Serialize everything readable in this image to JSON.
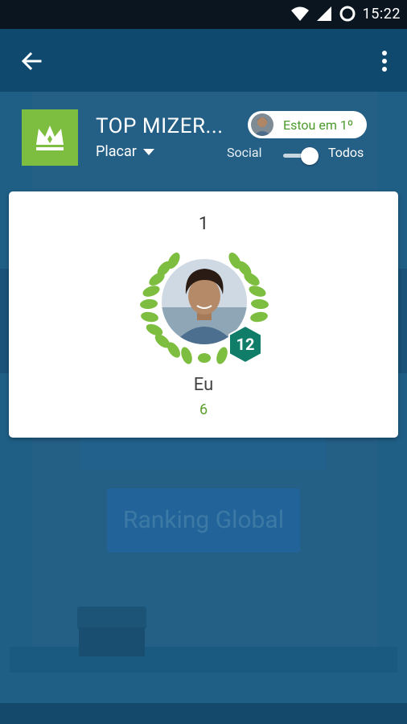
{
  "status_bar": {
    "time": "15:22"
  },
  "header": {
    "title": "TOP MIZER...",
    "placar_label": "Placar",
    "pill_text": "Estou em 1º",
    "social_label": "Social",
    "todos_label": "Todos",
    "toggle_on": true
  },
  "leader_card": {
    "rank": "1",
    "player_name": "Eu",
    "score": "6",
    "level": "12"
  },
  "background": {
    "button_label": "Ranking Global"
  },
  "colors": {
    "app_bar": "#0f4a6e",
    "accent_green": "#7dbd3f",
    "badge_teal": "#0f7d68",
    "background": "#1f5f86"
  },
  "icons": [
    "back-arrow-icon",
    "more-vert-icon",
    "crown-icon",
    "wifi-icon",
    "signal-icon",
    "battery-icon",
    "dropdown-caret-icon",
    "laurel-wreath-icon",
    "hexagon-level-badge"
  ]
}
